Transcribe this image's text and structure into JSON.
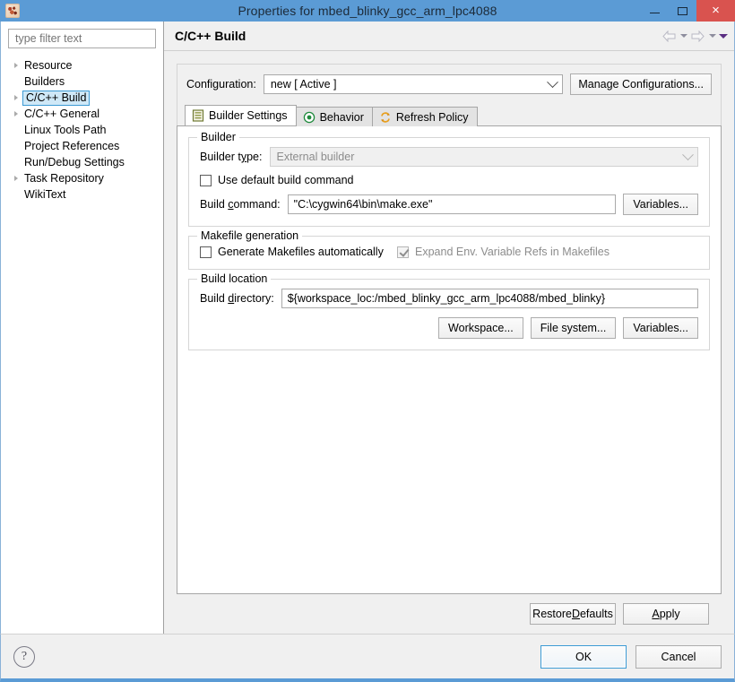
{
  "window": {
    "title": "Properties for mbed_blinky_gcc_arm_lpc4088",
    "icon": "app-icon",
    "minimize_label": "Minimize",
    "maximize_label": "Maximize",
    "close_label": "×",
    "accent_color": "#5b9bd5",
    "close_color": "#d9534f"
  },
  "sidebar": {
    "filter": {
      "placeholder": "type filter text",
      "value": ""
    },
    "items": [
      {
        "label": "Resource",
        "expandable": true,
        "selected": false
      },
      {
        "label": "Builders",
        "expandable": false,
        "selected": false
      },
      {
        "label": "C/C++ Build",
        "expandable": true,
        "selected": true
      },
      {
        "label": "C/C++ General",
        "expandable": true,
        "selected": false
      },
      {
        "label": "Linux Tools Path",
        "expandable": false,
        "selected": false
      },
      {
        "label": "Project References",
        "expandable": false,
        "selected": false
      },
      {
        "label": "Run/Debug Settings",
        "expandable": false,
        "selected": false
      },
      {
        "label": "Task Repository",
        "expandable": true,
        "selected": false
      },
      {
        "label": "WikiText",
        "expandable": false,
        "selected": false
      }
    ]
  },
  "page": {
    "title": "C/C++ Build",
    "nav": {
      "back_icon": "arrow-left-icon",
      "back_menu_icon": "chevron-down-icon",
      "forward_icon": "arrow-right-icon",
      "forward_menu_icon": "chevron-down-icon",
      "menu_icon": "chevron-down-filled-icon"
    }
  },
  "configuration": {
    "label": "Configuration:",
    "value": "new  [ Active ]",
    "manage_button": "Manage Configurations..."
  },
  "tabs": [
    {
      "label": "Builder Settings",
      "icon": "document-lines-icon",
      "active": true
    },
    {
      "label": "Behavior",
      "icon": "target-icon",
      "active": false
    },
    {
      "label": "Refresh Policy",
      "icon": "refresh-arrows-icon",
      "active": false
    }
  ],
  "builder_group": {
    "title": "Builder",
    "builder_type_label": "Builder type:",
    "builder_type_value": "External builder",
    "builder_type_disabled": true,
    "use_default_label": "Use default build command",
    "use_default_checked": false,
    "build_command_label": "Build command:",
    "build_command_value": "\"C:\\cygwin64\\bin\\make.exe\"",
    "variables_button": "Variables..."
  },
  "makefile_group": {
    "title": "Makefile generation",
    "generate_label": "Generate Makefiles automatically",
    "generate_checked": false,
    "expand_label": "Expand Env. Variable Refs in Makefiles",
    "expand_checked": true,
    "expand_disabled": true
  },
  "build_location_group": {
    "title": "Build location",
    "build_dir_label": "Build directory:",
    "build_dir_value": "${workspace_loc:/mbed_blinky_gcc_arm_lpc4088/mbed_blinky}",
    "workspace_button": "Workspace...",
    "filesystem_button": "File system...",
    "variables_button": "Variables..."
  },
  "footer": {
    "restore_defaults": "Restore Defaults",
    "apply": "Apply",
    "help_icon": "?",
    "ok": "OK",
    "cancel": "Cancel"
  }
}
